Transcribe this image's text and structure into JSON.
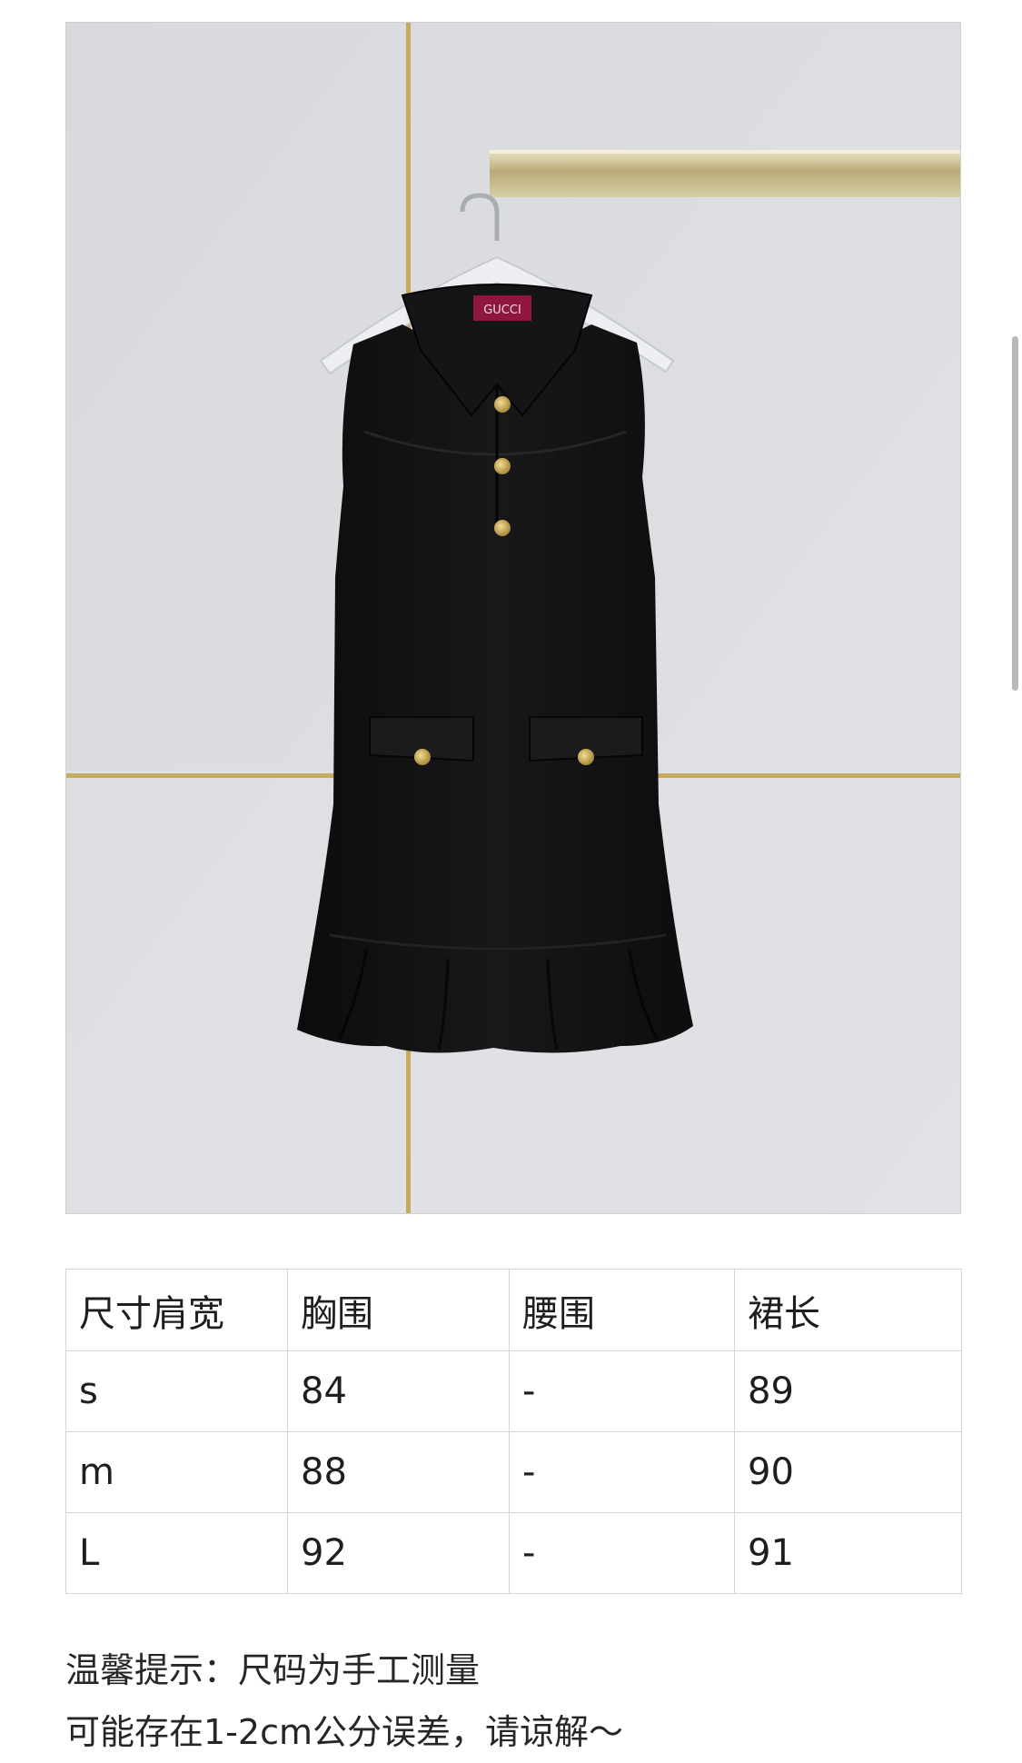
{
  "product_photo": {
    "label_text": "GUCCI",
    "colors": {
      "wall": "#dcdde1",
      "dress": "#111112",
      "gold_trim": "#c6ab5c",
      "label": "#8e1640"
    }
  },
  "size_table": {
    "headers": [
      "尺寸肩宽",
      "胸围",
      "腰围",
      "裙长"
    ],
    "rows": [
      [
        "s",
        "84",
        "-",
        "89"
      ],
      [
        "m",
        "88",
        "-",
        "90"
      ],
      [
        "L",
        "92",
        "-",
        "91"
      ]
    ]
  },
  "notice": {
    "line1": "温馨提示：尺码为手工测量",
    "line2": "可能存在1-2cm公分误差，请谅解～"
  }
}
